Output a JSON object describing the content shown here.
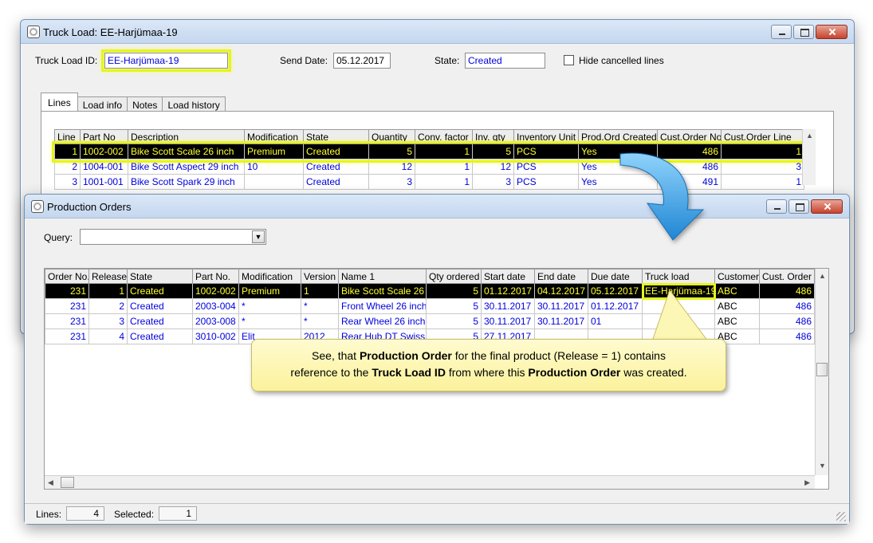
{
  "truck_window": {
    "title": "Truck Load: EE-Harjümaa-19",
    "id_label": "Truck Load ID:",
    "id_value": "EE-Harjümaa-19",
    "send_date_label": "Send Date:",
    "send_date_value": "05.12.2017",
    "state_label": "State:",
    "state_value": "Created",
    "hide_cancelled_label": "Hide cancelled lines",
    "tabs": [
      {
        "label": "Lines"
      },
      {
        "label": "Load info"
      },
      {
        "label": "Notes"
      },
      {
        "label": "Load history"
      }
    ],
    "columns": [
      "Line",
      "Part No",
      "Description",
      "Modification",
      "State",
      "Quantity",
      "Conv. factor",
      "Inv. qty",
      "Inventory Unit",
      "Prod.Ord Created",
      "Cust.Order No",
      "Cust.Order Line"
    ],
    "rows": [
      [
        "1",
        "1002-002",
        "Bike Scott Scale 26 inch",
        "Premium",
        "Created",
        "5",
        "1",
        "5",
        "PCS",
        "Yes",
        "486",
        "1"
      ],
      [
        "2",
        "1004-001",
        "Bike Scott Aspect 29 inch",
        "10",
        "Created",
        "12",
        "1",
        "12",
        "PCS",
        "Yes",
        "486",
        "3"
      ],
      [
        "3",
        "1001-001",
        "Bike Scott Spark 29 inch",
        "",
        "Created",
        "3",
        "1",
        "3",
        "PCS",
        "Yes",
        "491",
        "1"
      ]
    ]
  },
  "prod_window": {
    "title": "Production Orders",
    "query_label": "Query:",
    "query_value": "",
    "columns": [
      "Order No.",
      "Release",
      "State",
      "Part No.",
      "Modification",
      "Version",
      "Name 1",
      "Qty ordered",
      "Start date",
      "End date",
      "Due date",
      "Truck load",
      "Customer",
      "Cust. Order"
    ],
    "rows": [
      [
        "231",
        "1",
        "Created",
        "1002-002",
        "Premium",
        "1",
        "Bike Scott Scale 26 i",
        "5",
        "01.12.2017",
        "04.12.2017",
        "05.12.2017",
        "EE-Harjümaa-19",
        "ABC",
        "486"
      ],
      [
        "231",
        "2",
        "Created",
        "2003-004",
        "*",
        "*",
        "Front Wheel 26 inch",
        "5",
        "30.11.2017",
        "30.11.2017",
        "01.12.2017",
        "",
        "ABC",
        "486"
      ],
      [
        "231",
        "3",
        "Created",
        "2003-008",
        "*",
        "*",
        "Rear Wheel 26 inch",
        "5",
        "30.11.2017",
        "30.11.2017",
        "01",
        "",
        "ABC",
        "486"
      ],
      [
        "231",
        "4",
        "Created",
        "3010-002",
        "Elit",
        "2012",
        "Rear Hub DT Swiss",
        "5",
        "27.11.2017",
        "",
        "",
        "",
        "ABC",
        "486"
      ]
    ],
    "lines_label": "Lines:",
    "lines_value": "4",
    "selected_label": "Selected:",
    "selected_value": "1"
  },
  "callout": {
    "t1": "See, that ",
    "b1": "Production Order",
    "t2": " for the final product (Release = 1) contains",
    "t3": "reference to the ",
    "b2": "Truck Load ID",
    "t4": " from where this ",
    "b3": "Production Order",
    "t5": " was created."
  },
  "colors": {
    "highlight": "#e6f51c",
    "selected_row_bg": "#000000",
    "selected_row_text": "#ffff33",
    "data_text": "#0000dd",
    "arrow": "#2a9ae0"
  }
}
